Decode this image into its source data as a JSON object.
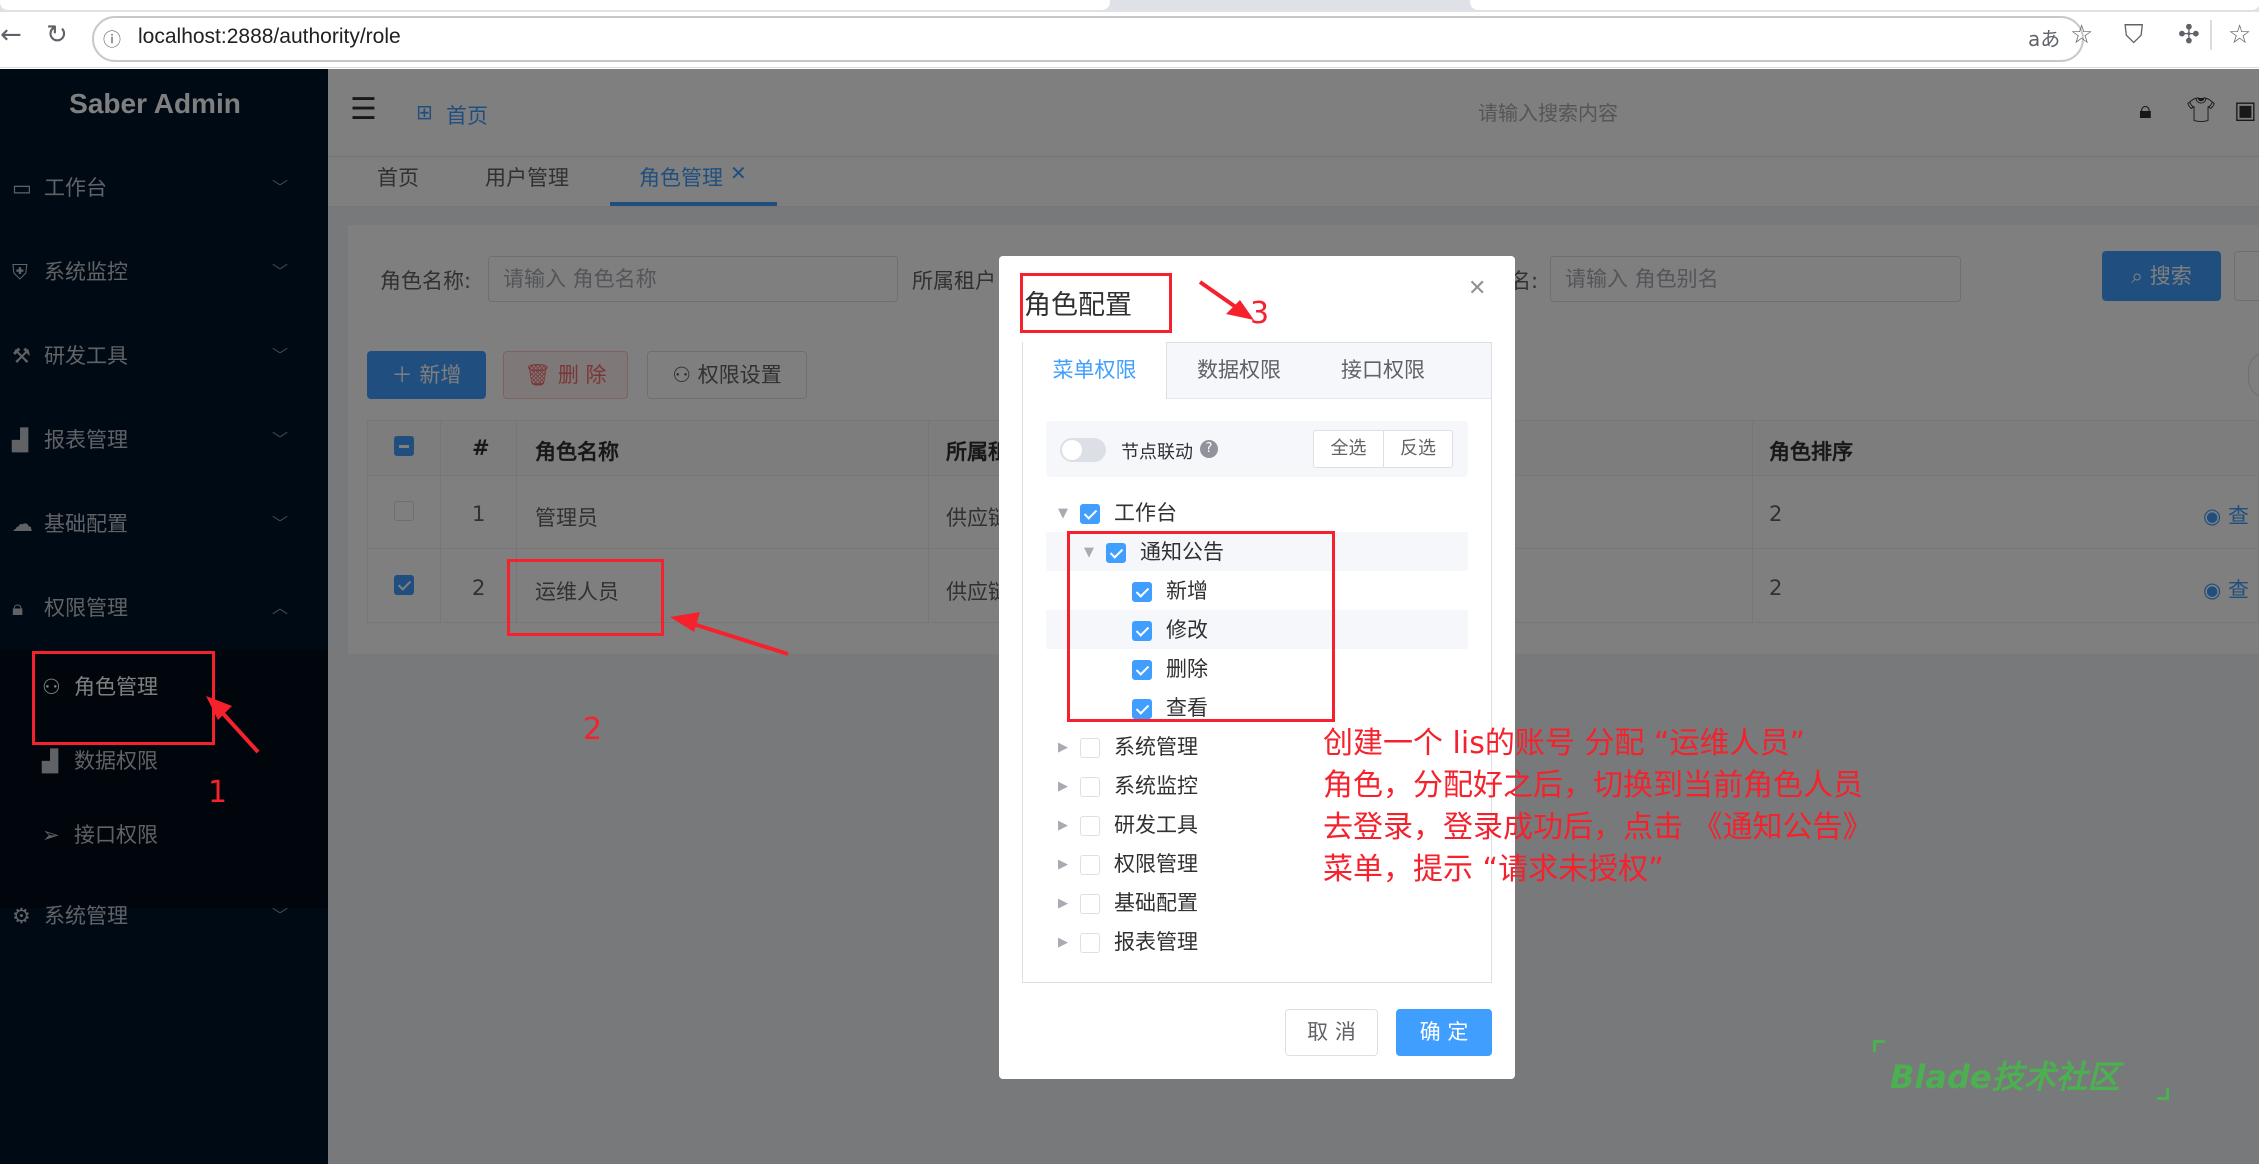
{
  "browser": {
    "url": "localhost:2888/authority/role"
  },
  "sidebar": {
    "logo": "Saber Admin",
    "items": [
      {
        "label": "工作台",
        "icon": "monitor-icon"
      },
      {
        "label": "系统监控",
        "icon": "shield-icon"
      },
      {
        "label": "研发工具",
        "icon": "wrench-icon"
      },
      {
        "label": "报表管理",
        "icon": "bar-chart-icon"
      },
      {
        "label": "基础配置",
        "icon": "cloud-icon"
      },
      {
        "label": "权限管理",
        "icon": "lock-icon"
      },
      {
        "label": "系统管理",
        "icon": "gear-icon"
      }
    ],
    "subitems": [
      {
        "label": "角色管理",
        "icon": "user-icon"
      },
      {
        "label": "数据权限",
        "icon": "bar-chart-icon"
      },
      {
        "label": "接口权限",
        "icon": "send-icon"
      }
    ]
  },
  "header": {
    "home": "首页",
    "search_placeholder": "请输入搜索内容"
  },
  "tags": [
    "首页",
    "用户管理",
    "角色管理"
  ],
  "search_form": {
    "role_name_label": "角色名称:",
    "role_name_placeholder": "请输入 角色名称",
    "tenant_label": "所属租户",
    "alias_label": "名:",
    "alias_placeholder": "请输入 角色别名",
    "search_button": "搜索"
  },
  "toolbar": {
    "add": "新增",
    "delete": "删 除",
    "permission": "权限设置"
  },
  "table": {
    "headers": [
      "#",
      "角色名称",
      "所属租",
      "角色排序"
    ],
    "rows": [
      {
        "index": "1",
        "name": "管理员",
        "tenant": "供应链",
        "sort": "2",
        "checked": false,
        "action": "查"
      },
      {
        "index": "2",
        "name": "运维人员",
        "tenant": "供应链",
        "sort": "2",
        "checked": true,
        "action": "查"
      }
    ]
  },
  "dialog": {
    "title": "角色配置",
    "tabs": [
      "菜单权限",
      "数据权限",
      "接口权限"
    ],
    "link_label": "节点联动",
    "select_all": "全选",
    "invert": "反选",
    "tree": [
      {
        "label": "工作台",
        "checked": true,
        "expanded": true,
        "level": 0
      },
      {
        "label": "通知公告",
        "checked": true,
        "expanded": true,
        "level": 1
      },
      {
        "label": "新增",
        "checked": true,
        "level": 2
      },
      {
        "label": "修改",
        "checked": true,
        "level": 2
      },
      {
        "label": "删除",
        "checked": true,
        "level": 2
      },
      {
        "label": "查看",
        "checked": true,
        "level": 2
      },
      {
        "label": "系统管理",
        "checked": false,
        "level": 0
      },
      {
        "label": "系统监控",
        "checked": false,
        "level": 0
      },
      {
        "label": "研发工具",
        "checked": false,
        "level": 0
      },
      {
        "label": "权限管理",
        "checked": false,
        "level": 0
      },
      {
        "label": "基础配置",
        "checked": false,
        "level": 0
      },
      {
        "label": "报表管理",
        "checked": false,
        "level": 0
      }
    ],
    "cancel": "取 消",
    "confirm": "确 定"
  },
  "annotations": {
    "n1": "1",
    "n2": "2",
    "n3": "3",
    "note_lines": [
      "创建一个 lis的账号 分配 “运维人员”",
      "角色，分配好之后，切换到当前角色人员",
      "去登录，登录成功后，点击 《通知公告》",
      "菜单，提示 “请求未授权”"
    ]
  },
  "watermark": "Blade技术社区",
  "colors": {
    "primary": "#409eff",
    "sidebar": "#001529",
    "annotation": "#f5222d",
    "watermark": "#4caf50"
  }
}
